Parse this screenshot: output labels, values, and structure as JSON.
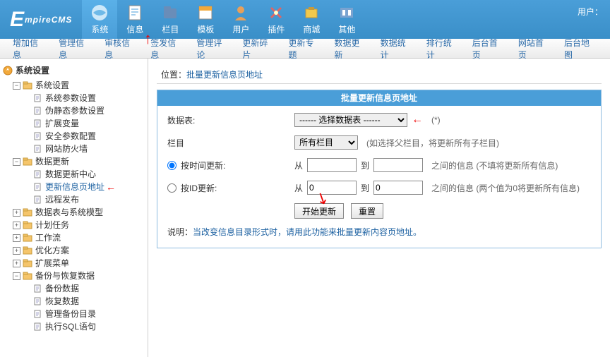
{
  "banner": {
    "logo": "EmpireCMS",
    "user_label": "用户：",
    "nav": [
      "系统",
      "信息",
      "栏目",
      "模板",
      "用户",
      "插件",
      "商城",
      "其他"
    ],
    "active_index": 0
  },
  "submenu": [
    "增加信息",
    "管理信息",
    "审核信息",
    "签发信息",
    "管理评论",
    "更新碎片",
    "更新专题",
    "数据更新",
    "数据统计",
    "排行统计",
    "后台首页",
    "网站首页",
    "后台地图"
  ],
  "sidebar": {
    "title": "系统设置",
    "nodes": [
      {
        "label": "系统设置",
        "expanded": true,
        "children": [
          {
            "label": "系统参数设置"
          },
          {
            "label": "伪静态参数设置"
          },
          {
            "label": "扩展变量"
          },
          {
            "label": "安全参数配置"
          },
          {
            "label": "网站防火墙"
          }
        ]
      },
      {
        "label": "数据更新",
        "expanded": true,
        "children": [
          {
            "label": "数据更新中心"
          },
          {
            "label": "更新信息页地址",
            "marked": true
          },
          {
            "label": "远程发布"
          }
        ]
      },
      {
        "label": "数据表与系统模型",
        "expanded": false
      },
      {
        "label": "计划任务",
        "expanded": false
      },
      {
        "label": "工作流",
        "expanded": false
      },
      {
        "label": "优化方案",
        "expanded": false
      },
      {
        "label": "扩展菜单",
        "expanded": false
      },
      {
        "label": "备份与恢复数据",
        "expanded": true,
        "children": [
          {
            "label": "备份数据"
          },
          {
            "label": "恢复数据"
          },
          {
            "label": "管理备份目录"
          },
          {
            "label": "执行SQL语句"
          }
        ]
      }
    ]
  },
  "breadcrumb": {
    "prefix": "位置：",
    "link": "批量更新信息页地址"
  },
  "panel": {
    "title": "批量更新信息页地址",
    "table_label": "数据表:",
    "table_select_placeholder": "------ 选择数据表 ------",
    "table_hint": "(*)",
    "column_label": "栏目",
    "column_select_value": "所有栏目",
    "column_hint": "(如选择父栏目，将更新所有子栏目)",
    "by_time_label": "按时间更新:",
    "by_id_label": "按ID更新:",
    "from_label": "从",
    "to_label": "到",
    "time_hint": "之间的信息 (不填将更新所有信息)",
    "id_hint": "之间的信息 (两个值为0将更新所有信息)",
    "id_from_value": "0",
    "id_to_value": "0",
    "btn_submit": "开始更新",
    "btn_reset": "重置",
    "note_label": "说明：",
    "note_text": "当改变信息目录形式时，请用此功能来批量更新内容页地址。"
  }
}
